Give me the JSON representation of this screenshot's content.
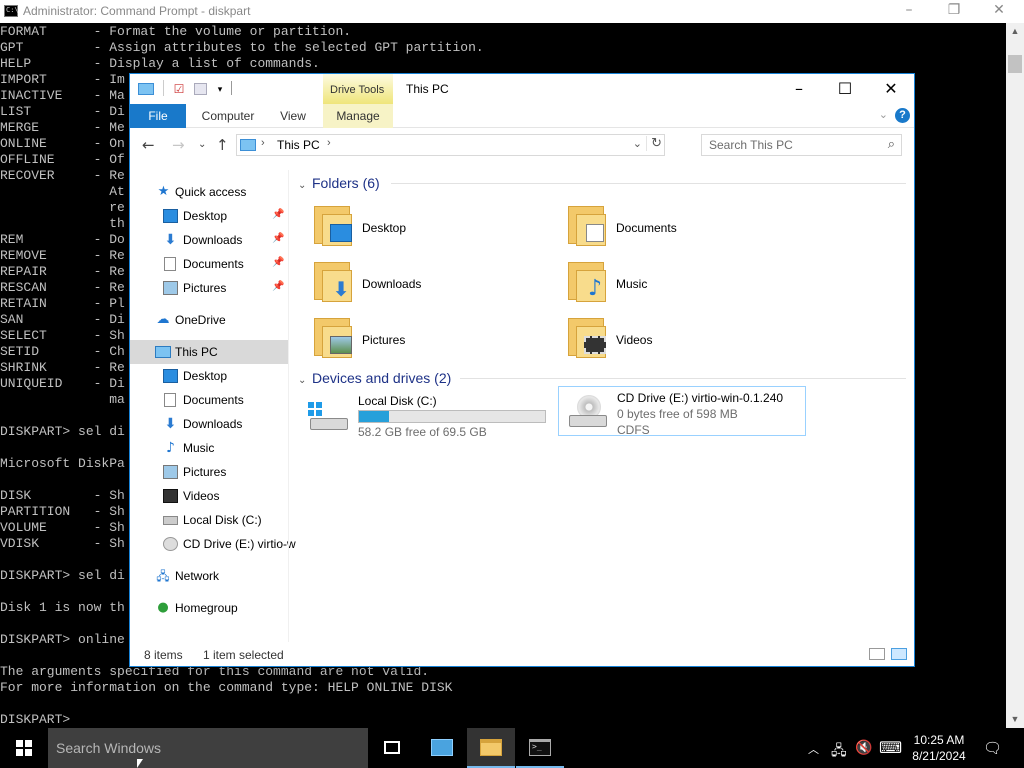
{
  "cmd": {
    "title": "Administrator: Command Prompt - diskpart",
    "icon_text": "C:\\",
    "lines": [
      "FORMAT      - Format the volume or partition.",
      "GPT         - Assign attributes to the selected GPT partition.",
      "HELP        - Display a list of commands.",
      "IMPORT      - Im",
      "INACTIVE    - Ma",
      "LIST        - Di",
      "MERGE       - Me",
      "ONLINE      - On",
      "OFFLINE     - Of",
      "RECOVER     - Re",
      "              At",
      "              re",
      "              th",
      "REM         - Do",
      "REMOVE      - Re",
      "REPAIR      - Re",
      "RESCAN      - Re",
      "RETAIN      - Pl",
      "SAN         - Di",
      "SELECT      - Sh",
      "SETID       - Ch",
      "SHRINK      - Re",
      "UNIQUEID    - Di",
      "              ma",
      "",
      "DISKPART> sel di",
      "",
      "Microsoft DiskPa",
      "",
      "DISK        - Sh",
      "PARTITION   - Sh",
      "VOLUME      - Sh",
      "VDISK       - Sh",
      "",
      "DISKPART> sel di",
      "",
      "Disk 1 is now th",
      "",
      "DISKPART> online",
      "",
      "The arguments specified for this command are not valid.",
      "For more information on the command type: HELP ONLINE DISK",
      "",
      "DISKPART>"
    ]
  },
  "explorer": {
    "title": "This PC",
    "contextual_tab": "Drive Tools",
    "tabs": {
      "file": "File",
      "computer": "Computer",
      "view": "View",
      "manage": "Manage"
    },
    "address": {
      "crumb": "This PC"
    },
    "search": {
      "placeholder": "Search This PC"
    },
    "nav": {
      "quick_access": "Quick access",
      "qa_items": [
        "Desktop",
        "Downloads",
        "Documents",
        "Pictures"
      ],
      "onedrive": "OneDrive",
      "this_pc": "This PC",
      "pc_items": [
        "Desktop",
        "Documents",
        "Downloads",
        "Music",
        "Pictures",
        "Videos",
        "Local Disk (C:)",
        "CD Drive (E:) virtio-w"
      ],
      "network": "Network",
      "homegroup": "Homegroup"
    },
    "folders": {
      "heading": "Folders (6)",
      "items": [
        "Desktop",
        "Documents",
        "Downloads",
        "Music",
        "Pictures",
        "Videos"
      ]
    },
    "devices": {
      "heading": "Devices and drives (2)",
      "local_disk": {
        "name": "Local Disk (C:)",
        "free": "58.2 GB free of 69.5 GB",
        "used_fraction": 0.163
      },
      "cd_drive": {
        "name": "CD Drive (E:) virtio-win-0.1.240",
        "free": "0 bytes free of 598 MB",
        "fs": "CDFS"
      }
    },
    "status": {
      "items": "8 items",
      "selected": "1 item selected"
    }
  },
  "taskbar": {
    "search_placeholder": "Search Windows",
    "time": "10:25 AM",
    "date": "8/21/2024"
  },
  "colors": {
    "accent": "#1979ca",
    "selection": "#99d1ff",
    "progress": "#26a0da",
    "group_heading": "#1e3287"
  }
}
